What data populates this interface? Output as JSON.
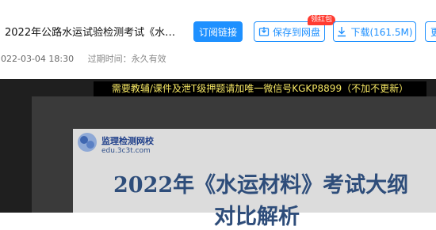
{
  "doc": {
    "title": "2022年公路水运试验检测考试《水运材…",
    "date": "2022-03-04 18:30",
    "validity": "过期时间：永久有效"
  },
  "actions": {
    "subscribe_label": "订阅链接",
    "save_label": "保存到网盘",
    "download_label": "下载(161.5M)",
    "more_label": "更",
    "badge": "领红包"
  },
  "preview": {
    "notice": "需要教辅/课件及泄T级押题请加唯一微信号KGKP8899（不加不更新）",
    "school_name": "监理检测网校",
    "school_url": "edu.3c3t.com",
    "headline": "2022年《水运材料》考试大纲",
    "headline2": "对比解析"
  },
  "colors": {
    "accent": "#1e90ff",
    "badge": "#ff3b30",
    "headline": "#2e4d7a"
  }
}
